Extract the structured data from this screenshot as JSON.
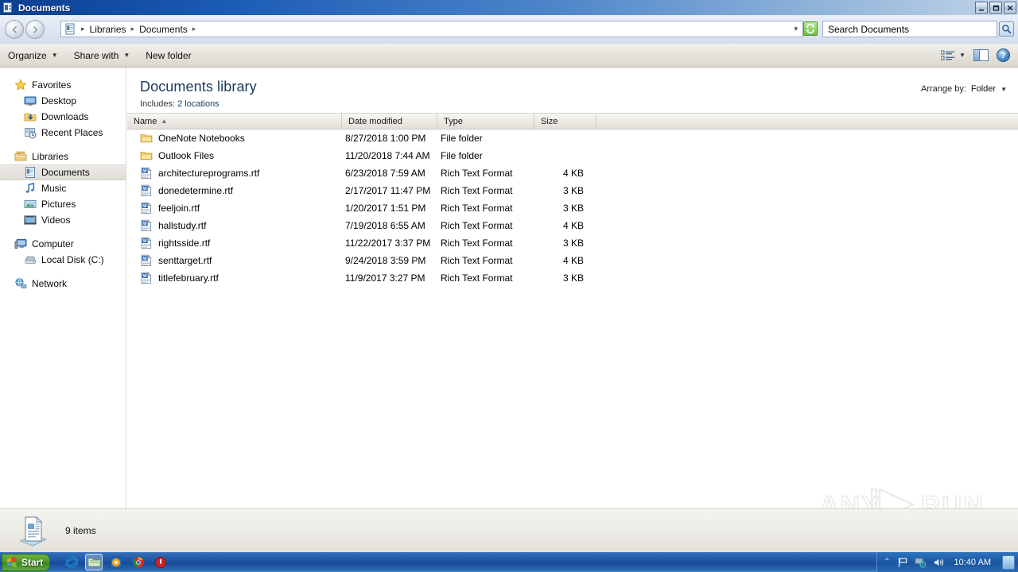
{
  "window": {
    "title": "Documents",
    "icon": "documents-library-icon",
    "controls": {
      "minimize": "_",
      "maximize": "❐",
      "close": "✕"
    }
  },
  "nav": {
    "back_label": "◄",
    "forward_label": "►",
    "breadcrumb": {
      "root_icon": "library-icon",
      "items": [
        "Libraries",
        "Documents"
      ],
      "separator": "▸",
      "dropdown": "▾"
    },
    "refresh_label": "⟳",
    "search": {
      "placeholder": "Search Documents",
      "value": "Search Documents",
      "icon": "search-icon"
    }
  },
  "commandbar": {
    "organize": "Organize",
    "share_with": "Share with",
    "new_folder": "New folder",
    "caret": "▼",
    "views_icon": "view-list-icon",
    "preview_pane_icon": "preview-pane-icon",
    "help_icon": "help-icon",
    "help_glyph": "?"
  },
  "sidebar": {
    "groups": [
      {
        "header": {
          "label": "Favorites",
          "icon": "star-icon"
        },
        "items": [
          {
            "label": "Desktop",
            "icon": "desktop-icon"
          },
          {
            "label": "Downloads",
            "icon": "downloads-icon"
          },
          {
            "label": "Recent Places",
            "icon": "recent-places-icon"
          }
        ]
      },
      {
        "header": {
          "label": "Libraries",
          "icon": "libraries-icon"
        },
        "items": [
          {
            "label": "Documents",
            "icon": "documents-icon",
            "selected": true
          },
          {
            "label": "Music",
            "icon": "music-icon"
          },
          {
            "label": "Pictures",
            "icon": "pictures-icon"
          },
          {
            "label": "Videos",
            "icon": "videos-icon"
          }
        ]
      },
      {
        "header": {
          "label": "Computer",
          "icon": "computer-icon"
        },
        "items": [
          {
            "label": "Local Disk (C:)",
            "icon": "hard-disk-icon"
          }
        ]
      },
      {
        "header": {
          "label": "Network",
          "icon": "network-icon"
        },
        "items": []
      }
    ]
  },
  "library": {
    "title": "Documents library",
    "includes_label": "Includes:",
    "includes_value": "2 locations",
    "arrange_label": "Arrange by:",
    "arrange_value": "Folder",
    "arrange_caret": "▼"
  },
  "columns": {
    "name": "Name",
    "sort_indicator": "▲",
    "date_modified": "Date modified",
    "type": "Type",
    "size": "Size"
  },
  "files": [
    {
      "name": "OneNote Notebooks",
      "date": "8/27/2018 1:00 PM",
      "type": "File folder",
      "size": "",
      "icon": "folder-icon"
    },
    {
      "name": "Outlook Files",
      "date": "11/20/2018 7:44 AM",
      "type": "File folder",
      "size": "",
      "icon": "folder-icon"
    },
    {
      "name": "architectureprograms.rtf",
      "date": "6/23/2018 7:59 AM",
      "type": "Rich Text Format",
      "size": "4 KB",
      "icon": "rtf-file-icon"
    },
    {
      "name": "donedetermine.rtf",
      "date": "2/17/2017 11:47 PM",
      "type": "Rich Text Format",
      "size": "3 KB",
      "icon": "rtf-file-icon"
    },
    {
      "name": "feeljoin.rtf",
      "date": "1/20/2017 1:51 PM",
      "type": "Rich Text Format",
      "size": "3 KB",
      "icon": "rtf-file-icon"
    },
    {
      "name": "hallstudy.rtf",
      "date": "7/19/2018 6:55 AM",
      "type": "Rich Text Format",
      "size": "4 KB",
      "icon": "rtf-file-icon"
    },
    {
      "name": "rightsside.rtf",
      "date": "11/22/2017 3:37 PM",
      "type": "Rich Text Format",
      "size": "3 KB",
      "icon": "rtf-file-icon"
    },
    {
      "name": "senttarget.rtf",
      "date": "9/24/2018 3:59 PM",
      "type": "Rich Text Format",
      "size": "4 KB",
      "icon": "rtf-file-icon"
    },
    {
      "name": "titlefebruary.rtf",
      "date": "11/9/2017 3:27 PM",
      "type": "Rich Text Format",
      "size": "3 KB",
      "icon": "rtf-file-icon"
    }
  ],
  "statusbar": {
    "item_count": "9 items",
    "icon": "documents-stack-icon"
  },
  "watermark": {
    "text_left": "ANY",
    "text_right": "RUN"
  },
  "taskbar": {
    "start_label": "Start",
    "quicklaunch": [
      {
        "name": "internet-explorer-icon",
        "active": false
      },
      {
        "name": "windows-explorer-icon",
        "active": true
      },
      {
        "name": "media-player-icon",
        "active": false
      },
      {
        "name": "chrome-icon",
        "active": false
      },
      {
        "name": "stop-app-icon",
        "active": false
      }
    ],
    "tray": {
      "expand": "⌃",
      "flag_icon": "flag-icon",
      "network-icon": "network-tray-icon",
      "volume_icon": "volume-icon",
      "clock": "10:40 AM",
      "show_desktop": "show-desktop-button"
    }
  },
  "colors": {
    "titlebar_start": "#0b3f8f",
    "accent_blue": "#1b5bb5",
    "folder_yellow": "#f8d477",
    "selection_gray": "#e7e4de"
  }
}
